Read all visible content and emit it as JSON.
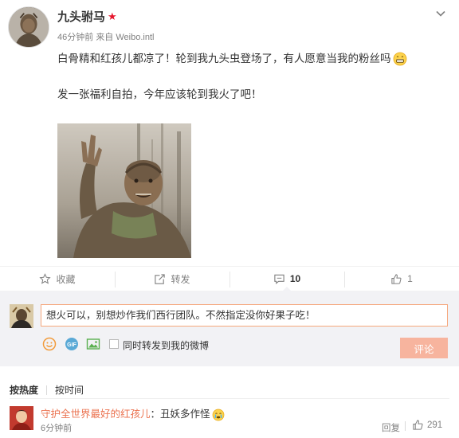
{
  "post": {
    "username": "九头驸马",
    "time": "46分钟前",
    "source_prefix": "来自",
    "source": "Weibo.intl",
    "text_line1": "白骨精和红孩儿都凉了！轮到我九头虫登场了，有人愿意当我的粉丝吗",
    "text_line2": "发一张福利自拍，今年应该轮到我火了吧！"
  },
  "actions": {
    "favorite_label": "收藏",
    "repost_label": "转发",
    "comment_count": "10",
    "like_count": "1"
  },
  "composer": {
    "input_value": "想火可以，别想炒作我们西行团队。不然指定没你好果子吃！",
    "repost_checkbox_label": "同时转发到我的微博",
    "submit_label": "评论"
  },
  "sort": {
    "hot_label": "按热度",
    "time_label": "按时间"
  },
  "comments": [
    {
      "user": "守护全世界最好的红孩儿",
      "separator": "：",
      "text": "丑妖多作怪",
      "time": "6分钟前",
      "reply_label": "回复",
      "like_count": "291"
    }
  ],
  "colors": {
    "accent_orange": "#eb7350",
    "verified_star": "#e6162d",
    "submit_bg": "#f7b49e",
    "composer_bg": "#f2f2f5"
  },
  "icons": {
    "header_menu": "chevron-down-icon",
    "favorite": "star-outline-icon",
    "repost": "repost-icon",
    "comment": "comment-icon",
    "like": "thumbs-up-icon",
    "emoji": "smile-icon",
    "gif": "gif-icon",
    "picture": "picture-icon"
  }
}
